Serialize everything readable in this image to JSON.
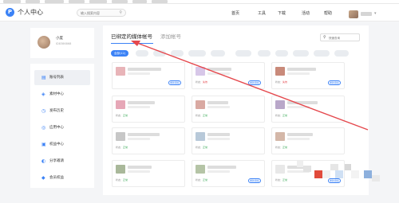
{
  "app": {
    "logo_letter": "P",
    "title": "个人中心",
    "search_placeholder": "输入搜索内容",
    "search_icon": "search-icon"
  },
  "nav": [
    "首页",
    "工具",
    "下载",
    "活动",
    "帮助"
  ],
  "profile": {
    "name": "小度",
    "id_text": "ID8386868"
  },
  "sidebar": {
    "items": [
      {
        "label": "账号列表",
        "icon": "list-icon",
        "glyph": "▤",
        "active": true
      },
      {
        "label": "素材中心",
        "icon": "folder-icon",
        "glyph": "◈",
        "active": false
      },
      {
        "label": "发布历史",
        "icon": "history-icon",
        "glyph": "◷",
        "active": false
      },
      {
        "label": "应用中心",
        "icon": "apps-icon",
        "glyph": "◎",
        "active": false
      },
      {
        "label": "权益中心",
        "icon": "gift-icon",
        "glyph": "▣",
        "active": false
      },
      {
        "label": "分享邀请",
        "icon": "share-icon",
        "glyph": "◐",
        "active": false
      },
      {
        "label": "会员权益",
        "icon": "crown-icon",
        "glyph": "◆",
        "active": false
      }
    ]
  },
  "main": {
    "tabs": [
      {
        "label": "已绑定的媒体帐号",
        "active": true
      },
      {
        "label": "添加帐号",
        "active": false
      }
    ],
    "search_placeholder": "快速查询",
    "filters": [
      "全部(12)"
    ],
    "cards": [
      {
        "meta_prefix": "",
        "meta_status": "",
        "status_class": "ok",
        "button": "重新授权",
        "thumb": "#e8b4b8"
      },
      {
        "meta_prefix": "状态：",
        "meta_status": "失效",
        "status_class": "err",
        "button": "重新授权",
        "thumb": "#d7c7e8"
      },
      {
        "meta_prefix": "状态：",
        "meta_status": "失效",
        "status_class": "err",
        "button": "重新授权",
        "thumb": "#c98a7a"
      },
      {
        "meta_prefix": "状态：",
        "meta_status": "正常",
        "status_class": "ok",
        "button": "",
        "thumb": "#e6a7b7"
      },
      {
        "meta_prefix": "状态：",
        "meta_status": "正常",
        "status_class": "ok",
        "button": "",
        "thumb": "#d9a9a2"
      },
      {
        "meta_prefix": "状态：",
        "meta_status": "正常",
        "status_class": "ok",
        "button": "",
        "thumb": "#b9a7c9"
      },
      {
        "meta_prefix": "状态：",
        "meta_status": "正常",
        "status_class": "ok",
        "button": "",
        "thumb": "#c7c7c7"
      },
      {
        "meta_prefix": "状态：",
        "meta_status": "正常",
        "status_class": "ok",
        "button": "",
        "thumb": "#b8c9d9"
      },
      {
        "meta_prefix": "状态：",
        "meta_status": "正常",
        "status_class": "ok",
        "button": "",
        "thumb": "#d4b7a8"
      },
      {
        "meta_prefix": "状态：",
        "meta_status": "正常",
        "status_class": "ok",
        "button": "",
        "thumb": "#a9b89a"
      },
      {
        "meta_prefix": "状态：",
        "meta_status": "正常",
        "status_class": "ok",
        "button": "重新授权",
        "thumb": "#b5c4a6"
      },
      {
        "meta_prefix": "状态：",
        "meta_status": "正常",
        "status_class": "ok",
        "button": "重新授权",
        "thumb": "#e8e8e8"
      }
    ]
  },
  "colors": {
    "accent": "#3b82f6",
    "annotation_arrow": "#e5484d",
    "ok": "#34a853",
    "error": "#e5484d"
  }
}
